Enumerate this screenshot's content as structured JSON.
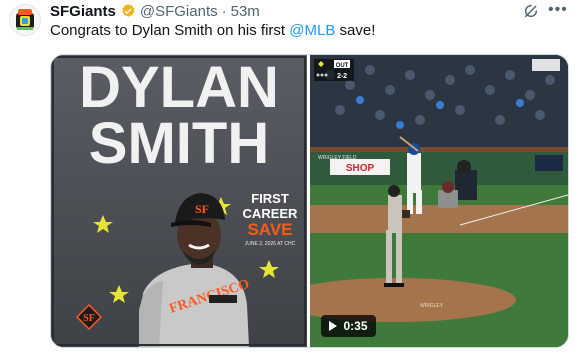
{
  "account": {
    "name": "SFGiants",
    "handle": "@SFGiants",
    "separator": "·",
    "time": "53m"
  },
  "tweet": {
    "text_before": "Congrats to Dylan Smith on his first ",
    "mention": "@MLB",
    "text_after": " save!"
  },
  "graphic": {
    "first_name": "DYLAN",
    "last_name": "SMITH",
    "line1": "FIRST",
    "line2": "CAREER",
    "line3": "SAVE",
    "date": "JUNE 2, 2026 AT CHC"
  },
  "video": {
    "duration": "0:35",
    "scorebug_outs": "OUT",
    "scorebug_count": "2-2",
    "sign_text": "SHOP",
    "wall_text": "WRIGLEY FIELD"
  },
  "colors": {
    "accent": "#1d9bf0",
    "giants_orange": "#fd5a1e",
    "star_yellow": "#e8e337",
    "verified": "#f2b21b"
  },
  "icons": [
    "verified-badge-icon",
    "grok-icon",
    "more-icon",
    "play-icon",
    "giants-logo-icon",
    "star-icon"
  ]
}
